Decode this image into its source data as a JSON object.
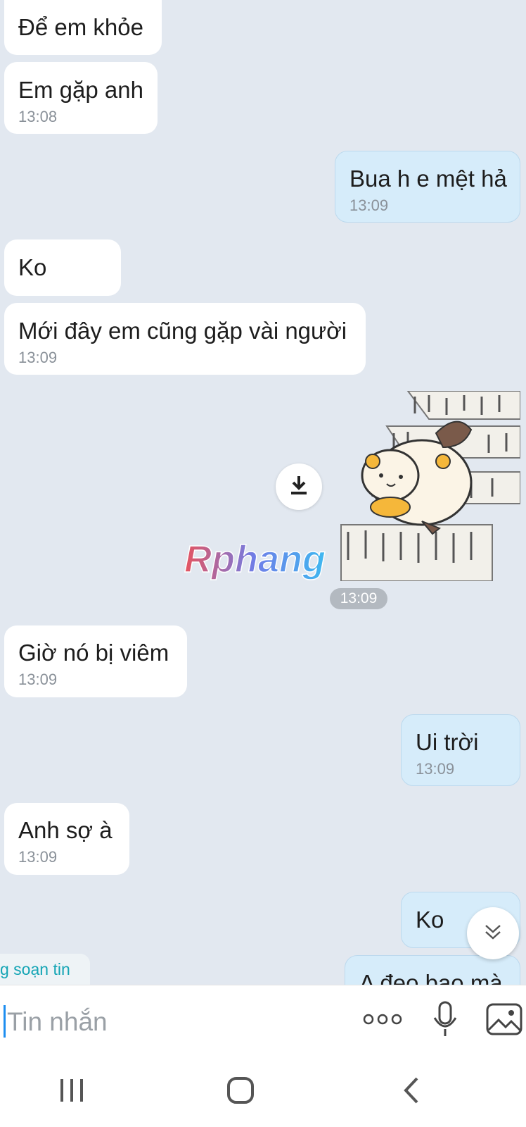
{
  "messages": [
    {
      "side": "in",
      "text": "Để em khỏe",
      "time": ""
    },
    {
      "side": "in",
      "text": "Em gặp anh",
      "time": "13:08"
    },
    {
      "side": "out",
      "text": "Bua h e mệt hả",
      "time": "13:09"
    },
    {
      "side": "in",
      "text": "Ko",
      "time": ""
    },
    {
      "side": "in",
      "text": "Mới đây em cũng gặp vài người",
      "time": "13:09"
    },
    {
      "side": "in",
      "text": "Giờ nó bị viêm",
      "time": "13:09"
    },
    {
      "side": "out",
      "text": "Ui trời",
      "time": "13:09"
    },
    {
      "side": "in",
      "text": "Anh sợ à",
      "time": "13:09"
    },
    {
      "side": "out",
      "text": "Ko",
      "time": ""
    },
    {
      "side": "out",
      "text": "A đeo bao mà",
      "time": ""
    }
  ],
  "sticker": {
    "time": "13:09",
    "watermark": "Rphang"
  },
  "typing_indicator": "g soạn tin",
  "input": {
    "placeholder": "Tin nhắn"
  },
  "icons": {
    "download": "download-icon",
    "scroll_down": "chevron-double-down-icon",
    "more": "more-dots-icon",
    "mic": "microphone-icon",
    "image": "image-icon",
    "nav_recent": "recent-apps-icon",
    "nav_home": "home-icon",
    "nav_back": "back-icon"
  },
  "colors": {
    "incoming": "#ffffff",
    "outgoing": "#d6ecfa",
    "background": "#e2e8f0",
    "accent": "#1d8ef0"
  }
}
